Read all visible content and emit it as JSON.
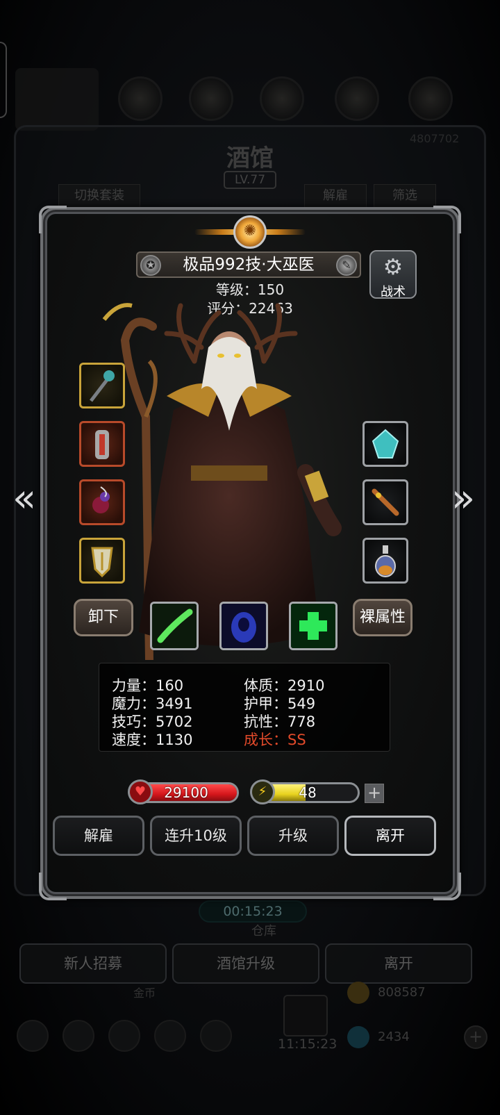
{
  "background": {
    "title": "酒馆",
    "level": "LV.77",
    "tabs": {
      "switch_outfit": "切换套装",
      "dismiss": "解雇",
      "filter": "筛选"
    },
    "timer": "00:15:23",
    "warehouse": "仓库",
    "buttons": {
      "recruit": "新人招募",
      "upgrade_tavern": "酒馆升级",
      "leave": "离开"
    },
    "gift_timer": "11:15:23",
    "resource_gold": "808587",
    "resource_gem": "2434",
    "hidden_label": "金币",
    "top_right_number": "4807702"
  },
  "hero": {
    "name": "极品992技·大巫医",
    "level_text": "等级：150",
    "score_text": "评分：22463",
    "tactics_label": "战术",
    "unequip_label": "卸下",
    "base_attr_label": "裸属性"
  },
  "equipment": {
    "left": [
      "staff-icon",
      "armor-icon",
      "amulet-icon",
      "shield-icon"
    ],
    "right": [
      "gem-icon",
      "dagger-icon",
      "potion-icon"
    ]
  },
  "skills": [
    "green-slash-icon",
    "blue-spirit-icon",
    "green-cross-icon"
  ],
  "stats": {
    "strength": "力量：160",
    "magic": "魔力：3491",
    "skill": "技巧：5702",
    "speed": "速度：1130",
    "constitution": "体质：2910",
    "armor": "护甲：549",
    "resistance": "抗性：778",
    "growth": "成长：SS"
  },
  "bars": {
    "hp": "29100",
    "hp_fill": 1.0,
    "energy": "48",
    "energy_fill": 0.48
  },
  "actions": {
    "dismiss": "解雇",
    "upgrade10": "连升10级",
    "upgrade": "升级",
    "leave": "离开"
  },
  "colors": {
    "hp": "#d4161b",
    "energy": "#e8d21e",
    "growth": "#e24a2a"
  }
}
